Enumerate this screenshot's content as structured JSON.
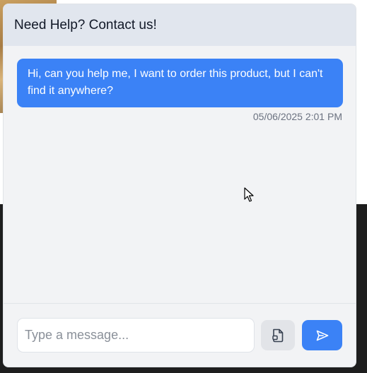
{
  "header": {
    "title": "Need Help? Contact us!"
  },
  "messages": [
    {
      "text": "Hi, can you help me, I want to order this product, but I can't find it anywhere?",
      "timestamp": "05/06/2025 2:01 PM"
    }
  ],
  "composer": {
    "placeholder": "Type a message...",
    "value": "",
    "attach_icon": "file-attach-icon",
    "send_icon": "send-icon"
  },
  "colors": {
    "accent": "#3b82f6",
    "header_bg": "#e1e6ee",
    "panel_bg": "#f2f3f5"
  }
}
